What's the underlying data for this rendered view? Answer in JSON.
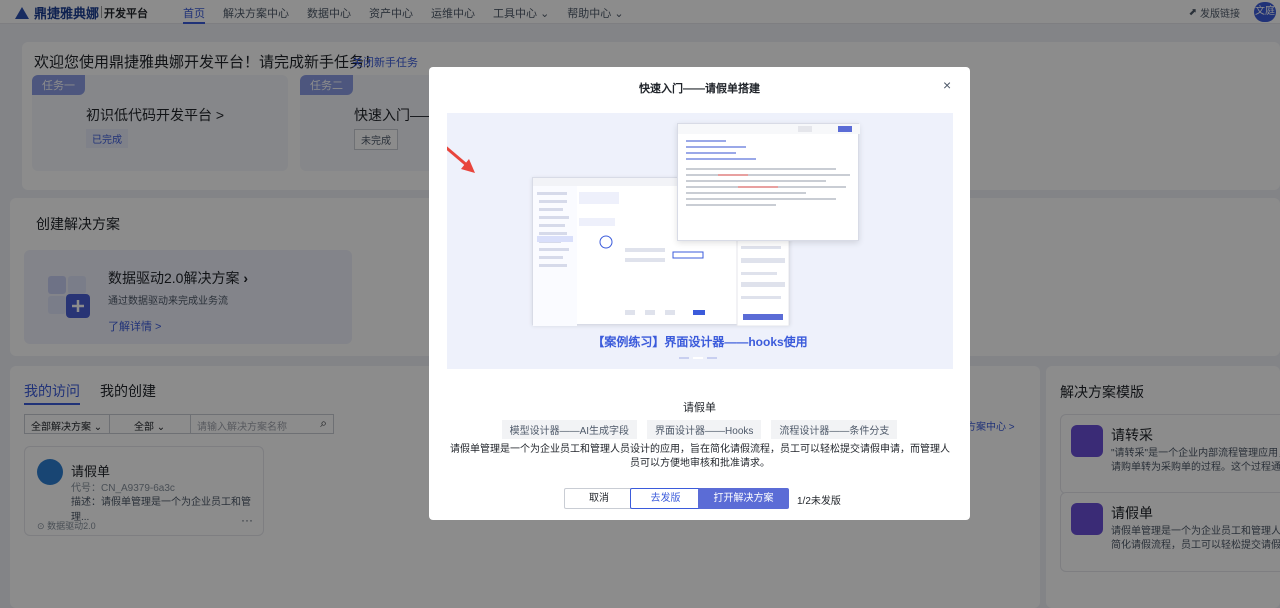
{
  "nav": {
    "brand": "鼎捷雅典娜",
    "sub": "开发平台",
    "items": [
      "首页",
      "解决方案中心",
      "数据中心",
      "资产中心",
      "运维中心",
      "工具中心",
      "帮助中心"
    ],
    "right_link": "发版链接",
    "avatar": "文庭"
  },
  "welcome": {
    "title": "欢迎您使用鼎捷雅典娜开发平台！请完成新手任务！",
    "close_label": "关闭新手任务",
    "tasks": [
      {
        "tag": "任务一",
        "name": "初识低代码开发平台 >",
        "status": "已完成"
      },
      {
        "tag": "任务二",
        "name": "快速入门——",
        "status": "未完成"
      }
    ]
  },
  "create": {
    "title": "创建解决方案",
    "card_name": "数据驱动2.0解决方案",
    "card_desc": "通过数据驱动来完成业务流",
    "card_link": "了解详情 >"
  },
  "visits": {
    "tabs": [
      "我的访问",
      "我的创建"
    ],
    "filter_all_solutions": "全部解决方案",
    "filter_all": "全部",
    "search_placeholder": "请输入解决方案名称",
    "solution_center": "方案中心 >",
    "app": {
      "name": "请假单",
      "code": "代号：CN_A9379-6a3c",
      "desc": "描述：请假单管理是一个为企业员工和管理...",
      "foot": "数据驱动2.0",
      "more": "···"
    }
  },
  "templates": {
    "title": "解决方案模版",
    "items": [
      {
        "name": "请转采",
        "desc": "\"请转采\"是一个企业内部流程管理应用，请购单转为采购单的过程。这个过程通常"
      },
      {
        "name": "请假单",
        "desc": "请假单管理是一个为企业员工和管理人员简化请假流程，员工可以轻松提交请假申"
      }
    ]
  },
  "modal": {
    "title": "快速入门——请假单搭建",
    "close": "×",
    "banner_caption": "【案例练习】界面设计器——hooks使用",
    "app_label": "请假单",
    "chips": [
      "模型设计器——AI生成字段",
      "界面设计器——Hooks",
      "流程设计器——条件分支"
    ],
    "desc": "请假单管理是一个为企业员工和管理人员设计的应用，旨在简化请假流程，员工可以轻松提交请假申请，而管理人员可以方便地审核和批准请求。",
    "buttons": {
      "cancel": "取消",
      "publish": "去发版",
      "open": "打开解决方案"
    },
    "publish_count": "1/2未发版"
  },
  "colors": {
    "accent": "#3b5bdb",
    "primary_button": "#5b6cd6",
    "arrow": "#e8453c"
  }
}
